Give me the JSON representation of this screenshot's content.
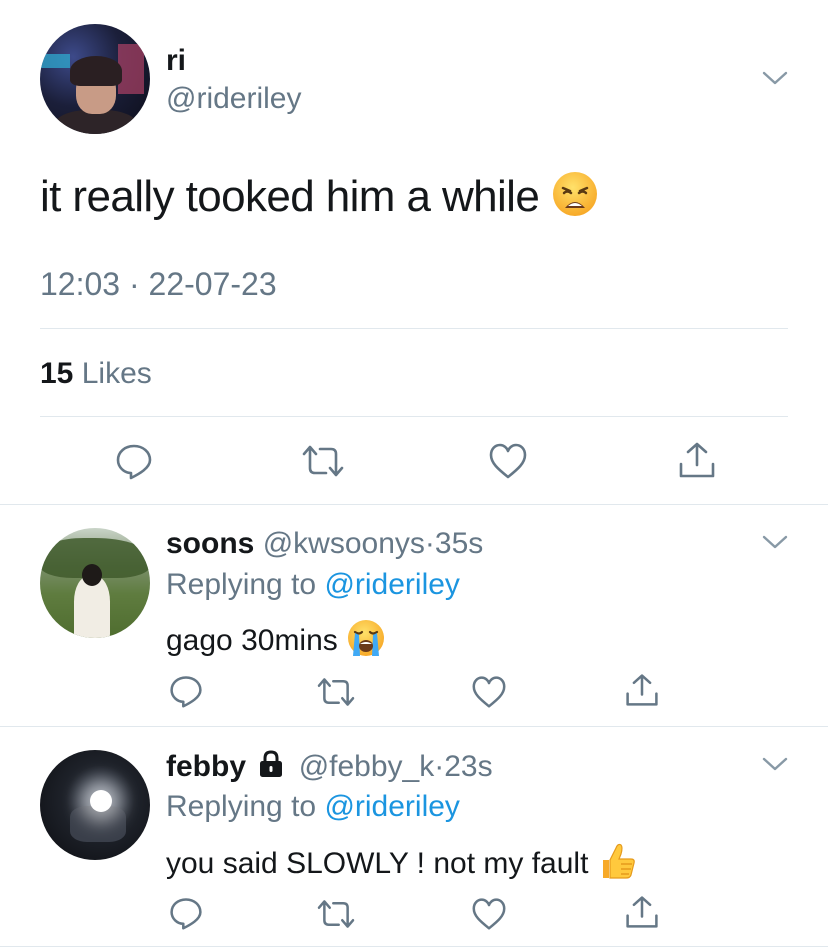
{
  "main_tweet": {
    "display_name": "ri",
    "handle": "@rideriley",
    "text": "it really tooked him a while",
    "emoji": "weary-face",
    "timestamp": "12:03 · 22-07-23",
    "likes_count": "15",
    "likes_label": "Likes",
    "actions": [
      "reply",
      "retweet",
      "like",
      "share"
    ]
  },
  "replies": [
    {
      "display_name": "soons",
      "handle": "@kwsoonys",
      "separator": "·",
      "time": "35s",
      "replying_prefix": "Replying to",
      "replying_to": "@rideriley",
      "text": "gago 30mins",
      "emoji": "loudly-crying-face",
      "protected": false
    },
    {
      "display_name": "febby",
      "handle": "@febby_k",
      "separator": "·",
      "time": "23s",
      "replying_prefix": "Replying to",
      "replying_to": "@rideriley",
      "text": "you said SLOWLY ! not my fault",
      "emoji": "thumbs-up",
      "protected": true
    }
  ],
  "colors": {
    "text": "#14171a",
    "secondary": "#657786",
    "link": "#1b95e0",
    "divider": "#e1e8ed",
    "icon": "#657786"
  }
}
